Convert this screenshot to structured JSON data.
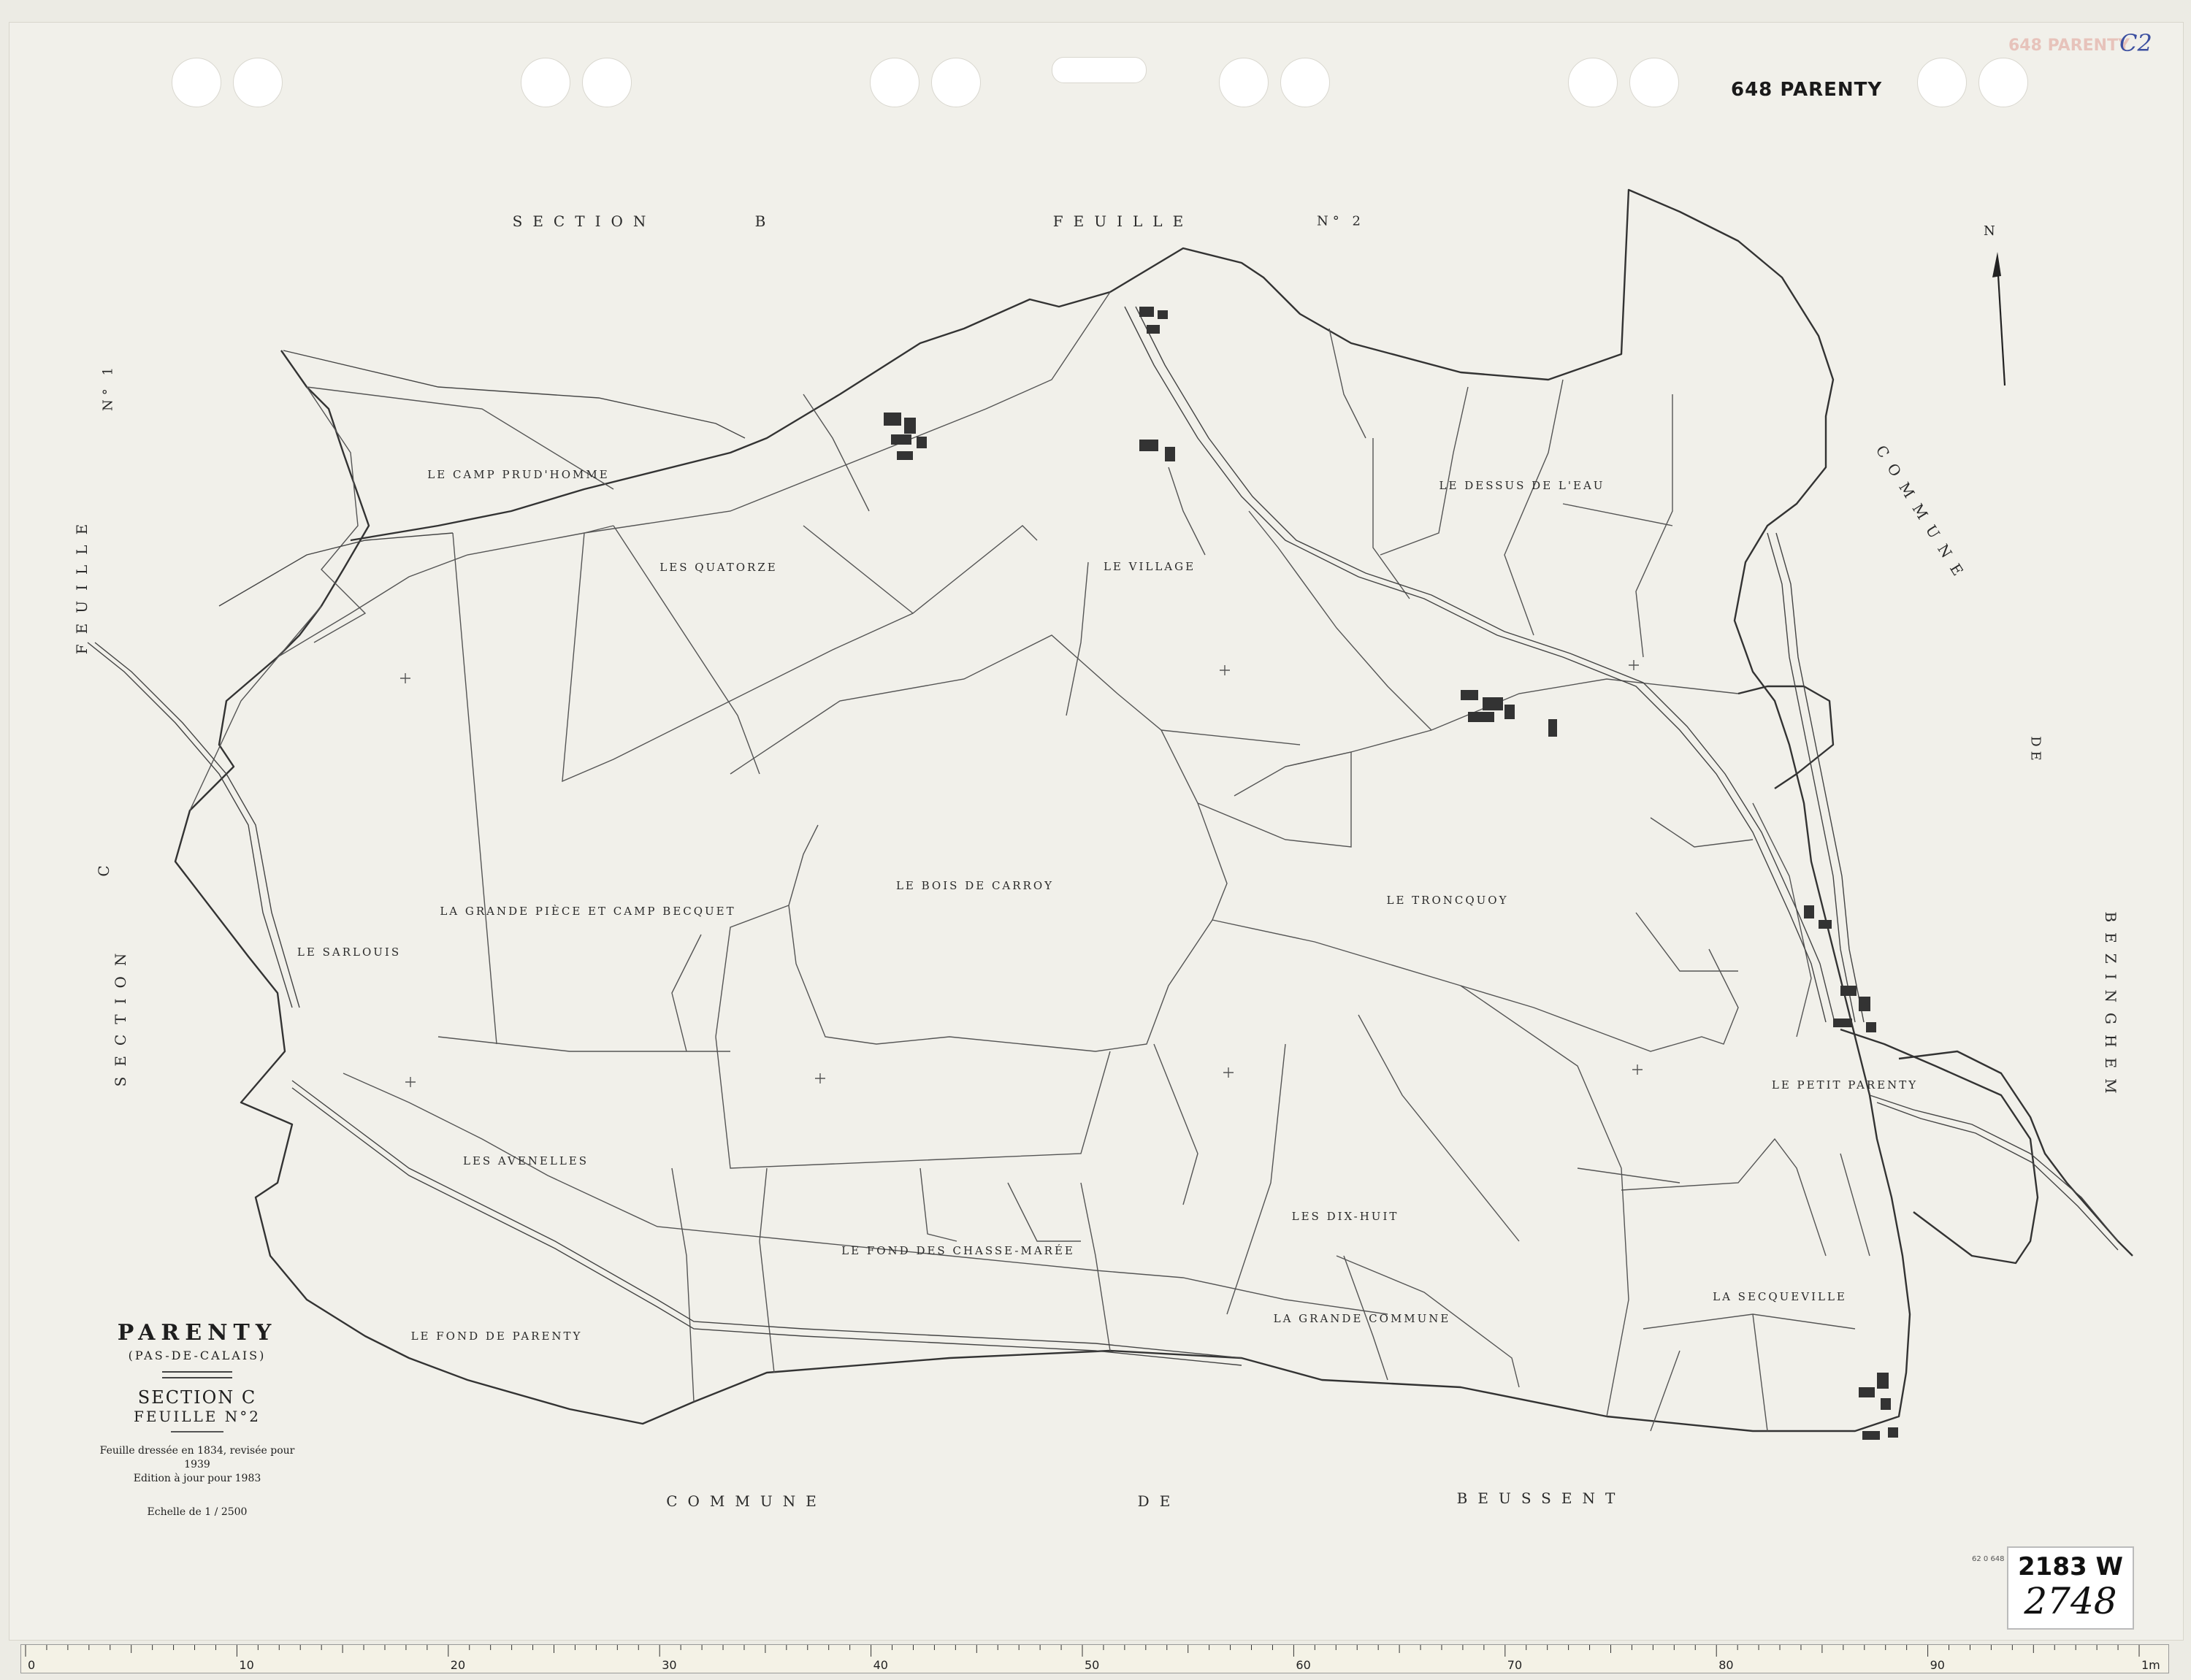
{
  "header": {
    "sheet_code": "648 PARENTY",
    "stamp_ghost": "648 PARENTY",
    "stamp_handwritten": "C2"
  },
  "adjacent": {
    "top_section": "SECTION",
    "top_section_letter": "B",
    "top_feuille": "FEUILLE",
    "top_feuille_num": "N° 2",
    "left_feuille": "FEUILLE",
    "left_n1": "N° 1",
    "left_c": "C",
    "left_section": "SECTION",
    "right_commune": "COMMUNE",
    "right_de": "DE",
    "right_bezinghem": "BEZINGHEM",
    "bottom_commune": "COMMUNE",
    "bottom_de": "DE",
    "bottom_beussent": "BEUSSENT"
  },
  "places": [
    "LE CAMP PRUD'HOMME",
    "LES QUATORZE",
    "LE VILLAGE",
    "LE DESSUS DE L'EAU",
    "LA GRANDE PIÈCE ET CAMP BECQUET",
    "LE BOIS DE CARROY",
    "LE TRONCQUOY",
    "LE SARLOUIS",
    "LES AVENELLES",
    "LE FOND DES CHASSE-MARÉE",
    "LES DIX-HUIT",
    "LE FOND DE PARENTY",
    "LA GRANDE COMMUNE",
    "LA SECQUEVILLE",
    "LE PETIT PARENTY"
  ],
  "compass": {
    "label": "N"
  },
  "legend": {
    "commune": "PARENTY",
    "department": "(PAS-DE-CALAIS)",
    "section": "SECTION C",
    "feuille": "FEUILLE N°2",
    "note_line1": "Feuille dressée en 1834, revisée pour 1939",
    "note_line2": "Edition à jour pour 1983",
    "scale": "Echelle de 1 / 2500"
  },
  "footer": {
    "small_ref": "62 0 648",
    "archive_code": "2183 W",
    "archive_number": "2748"
  },
  "ruler": {
    "major_labels": [
      "0",
      "10",
      "20",
      "30",
      "40",
      "50",
      "60",
      "70",
      "80",
      "90",
      "1m"
    ]
  }
}
